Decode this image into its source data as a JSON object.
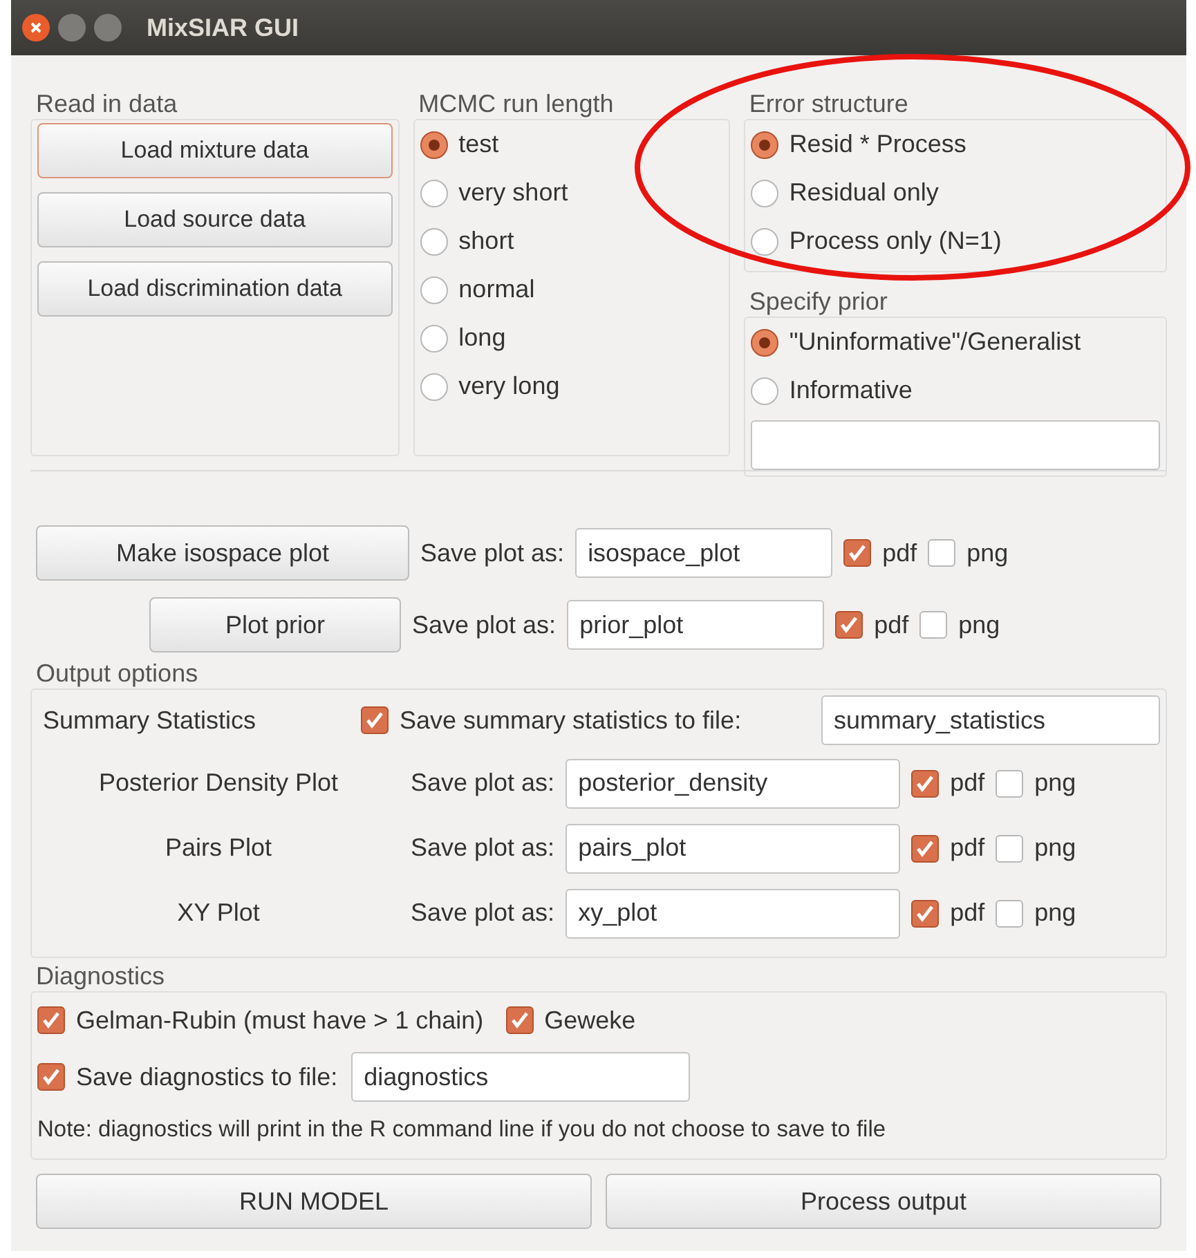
{
  "window": {
    "title": "MixSIAR GUI"
  },
  "read_in_data": {
    "title": "Read in data",
    "buttons": [
      {
        "label": "Load mixture data",
        "focused": true
      },
      {
        "label": "Load source data",
        "focused": false
      },
      {
        "label": "Load discrimination data",
        "focused": false
      }
    ]
  },
  "mcmc_run_length": {
    "title": "MCMC run length",
    "options": [
      {
        "label": "test",
        "selected": true
      },
      {
        "label": "very short",
        "selected": false
      },
      {
        "label": "short",
        "selected": false
      },
      {
        "label": "normal",
        "selected": false
      },
      {
        "label": "long",
        "selected": false
      },
      {
        "label": "very long",
        "selected": false
      }
    ]
  },
  "error_structure": {
    "title": "Error structure",
    "options": [
      {
        "label": "Resid * Process",
        "selected": true
      },
      {
        "label": "Residual only",
        "selected": false
      },
      {
        "label": "Process only (N=1)",
        "selected": false
      }
    ]
  },
  "specify_prior": {
    "title": "Specify prior",
    "options": [
      {
        "label": "\"Uninformative\"/Generalist",
        "selected": true
      },
      {
        "label": "Informative",
        "selected": false
      }
    ]
  },
  "plot_rows": [
    {
      "button": "Make isospace plot",
      "save_label": "Save plot as:",
      "value": "isospace_plot",
      "pdf": {
        "label": "pdf",
        "checked": true
      },
      "png": {
        "label": "png",
        "checked": false
      }
    },
    {
      "button": "Plot prior",
      "save_label": "Save plot as:",
      "value": "prior_plot",
      "pdf": {
        "label": "pdf",
        "checked": true
      },
      "png": {
        "label": "png",
        "checked": false
      }
    }
  ],
  "output_options": {
    "title": "Output options",
    "summary": {
      "label": "Summary Statistics",
      "checkbox_label": "Save summary statistics to file:",
      "checked": true,
      "value": "summary_statistics"
    },
    "plots": [
      {
        "label": "Posterior Density Plot",
        "save_label": "Save plot as:",
        "value": "posterior_density",
        "pdf": {
          "label": "pdf",
          "checked": true
        },
        "png": {
          "label": "png",
          "checked": false
        }
      },
      {
        "label": "Pairs Plot",
        "save_label": "Save plot as:",
        "value": "pairs_plot",
        "pdf": {
          "label": "pdf",
          "checked": true
        },
        "png": {
          "label": "png",
          "checked": false
        }
      },
      {
        "label": "XY Plot",
        "save_label": "Save plot as:",
        "value": "xy_plot",
        "pdf": {
          "label": "pdf",
          "checked": true
        },
        "png": {
          "label": "png",
          "checked": false
        }
      }
    ]
  },
  "diagnostics": {
    "title": "Diagnostics",
    "gelman_rubin": {
      "label": "Gelman-Rubin (must have > 1 chain)",
      "checked": true
    },
    "geweke": {
      "label": "Geweke",
      "checked": true
    },
    "save": {
      "label": "Save diagnostics to file:",
      "checked": true,
      "value": "diagnostics"
    },
    "note": "Note: diagnostics will print in the R command line if you do not choose to save to file"
  },
  "buttons": [
    "RUN MODEL",
    "Process output"
  ]
}
